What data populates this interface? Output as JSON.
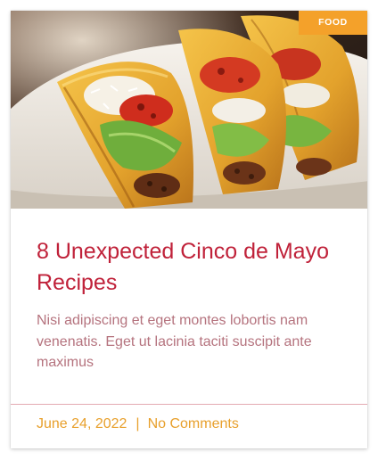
{
  "card": {
    "category": "Food",
    "image_alt": "Three crispy tacos with salsa, lettuce and cheese on a white plate",
    "title": "8 Unexpected Cinco de Mayo Recipes",
    "excerpt": "Nisi adipiscing et eget montes lobortis nam venenatis. Eget ut lacinia taciti suscipit ante maximus",
    "date": "June 24, 2022",
    "separator": "|",
    "comments": "No Comments"
  },
  "colors": {
    "title": "#c0223a",
    "excerpt": "#b5737e",
    "meta": "#e8a02c",
    "badge_bg": "#f4a12a",
    "divider": "#e3a9b1"
  }
}
